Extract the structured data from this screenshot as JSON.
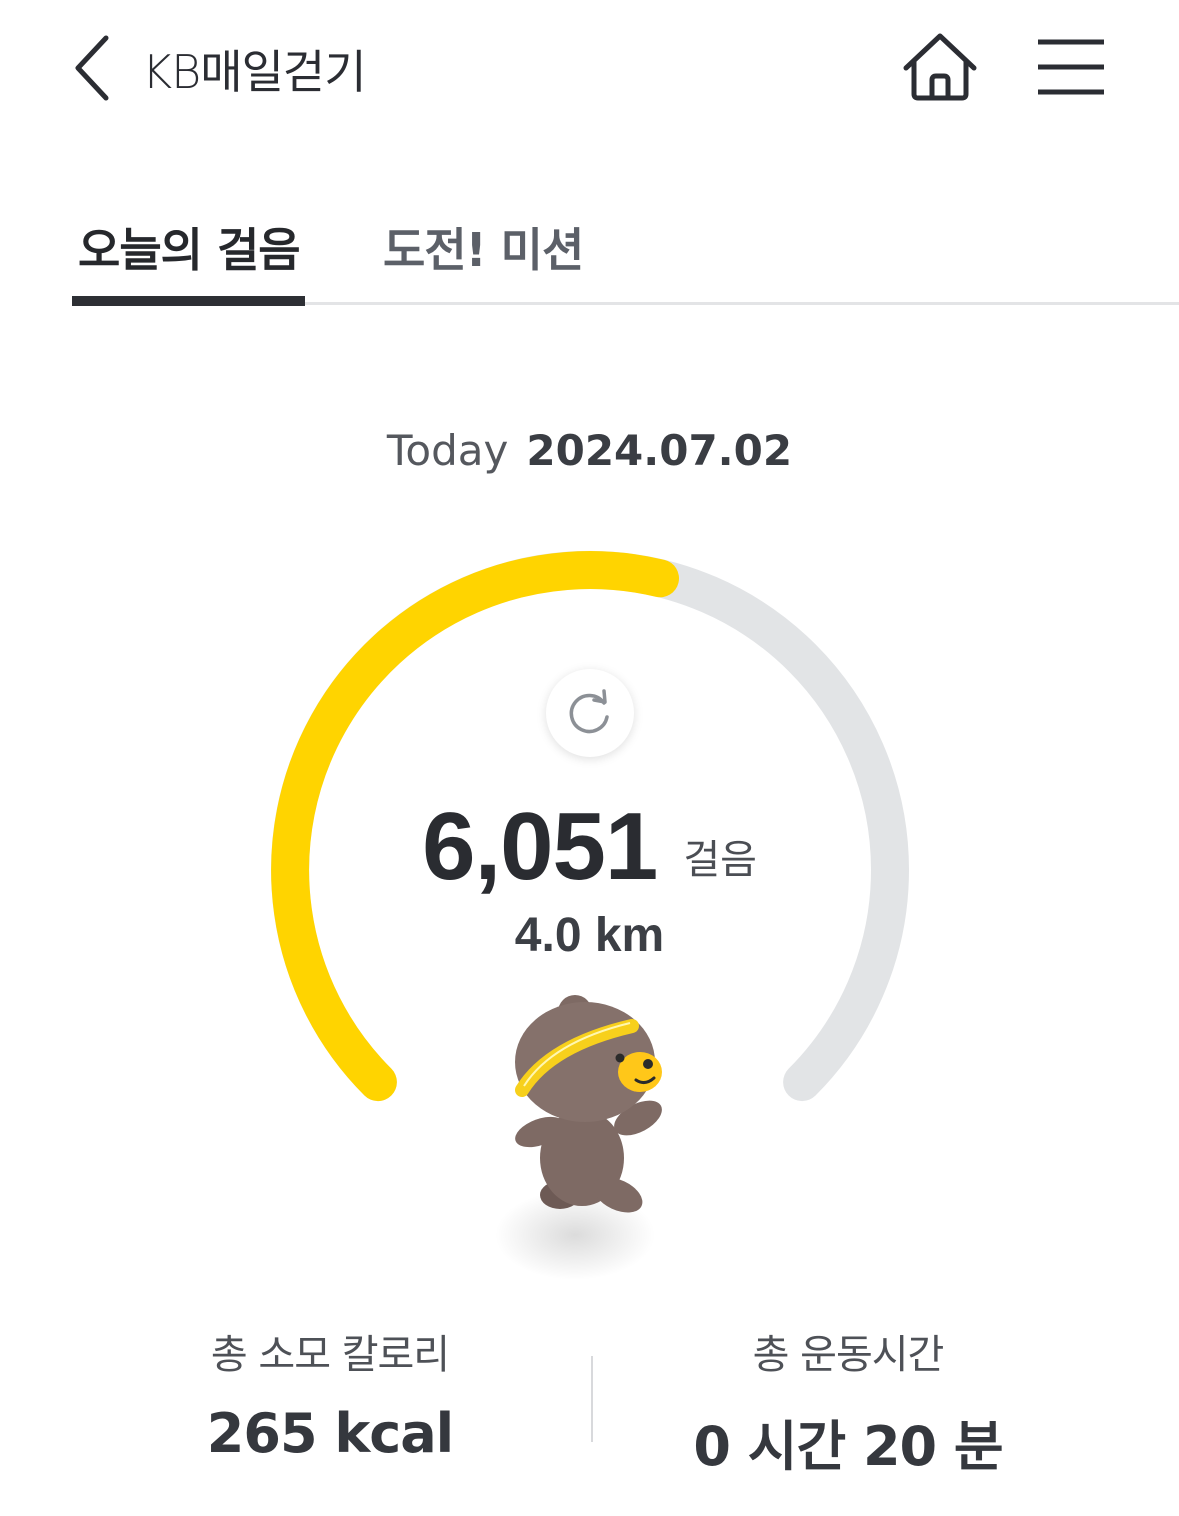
{
  "header": {
    "title": "KB매일걷기",
    "back_icon": "chevron-left-icon",
    "home_icon": "home-icon",
    "menu_icon": "hamburger-menu-icon"
  },
  "tabs": [
    {
      "label": "오늘의 걸음",
      "active": true
    },
    {
      "label": "도전! 미션",
      "active": false
    }
  ],
  "date": {
    "label": "Today",
    "value": "2024.07.02"
  },
  "progress": {
    "steps": "6,051",
    "steps_unit": "걸음",
    "distance": "4.0 km",
    "fraction": 0.55,
    "refresh_icon": "refresh-icon"
  },
  "stats": {
    "calories_label": "총 소모 칼로리",
    "calories_value": "265 kcal",
    "time_label": "총 운동시간",
    "time_value": "0 시간 20 분"
  },
  "colors": {
    "accent": "#FFD400",
    "track": "#E2E4E6",
    "text_dark": "#2A2C31",
    "bear_body": "#7E6A64"
  }
}
